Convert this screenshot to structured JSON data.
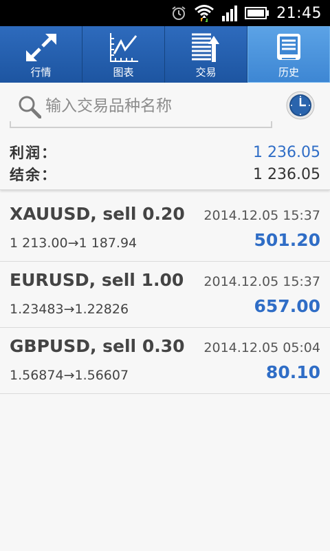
{
  "status_bar": {
    "time": "21:45",
    "icons": [
      "alarm-icon",
      "wifi-icon",
      "signal-icon",
      "battery-icon"
    ]
  },
  "tabs": [
    {
      "label": "行情",
      "icon": "quotes-arrows-icon",
      "active": false
    },
    {
      "label": "图表",
      "icon": "chart-icon",
      "active": false
    },
    {
      "label": "交易",
      "icon": "trade-icon",
      "active": false
    },
    {
      "label": "历史",
      "icon": "history-icon",
      "active": true
    }
  ],
  "search": {
    "placeholder": "输入交易品种名称",
    "value": ""
  },
  "summary": {
    "profit_label": "利润：",
    "profit_value": "1 236.05",
    "balance_label": "结余：",
    "balance_value": "1 236.05"
  },
  "trades": [
    {
      "symbol": "XAUUSD, sell 0.20",
      "datetime": "2014.12.05 15:37",
      "prices": "1 213.00→1 187.94",
      "profit": "501.20"
    },
    {
      "symbol": "EURUSD, sell 1.00",
      "datetime": "2014.12.05 15:37",
      "prices": "1.23483→1.22826",
      "profit": "657.00"
    },
    {
      "symbol": "GBPUSD, sell 0.30",
      "datetime": "2014.12.05 05:04",
      "prices": "1.56874→1.56607",
      "profit": "80.10"
    }
  ],
  "colors": {
    "tab_bar": "#1d55a1",
    "tab_active": "#4a93dc",
    "profit_blue": "#2f6dc6"
  }
}
